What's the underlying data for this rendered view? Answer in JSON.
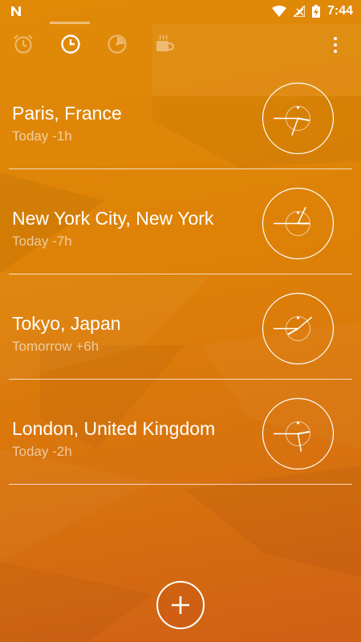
{
  "status_bar": {
    "time": "7:44"
  },
  "tabs": [
    {
      "name": "Alarm",
      "icon": "alarm-clock-icon",
      "selected": false
    },
    {
      "name": "World Clock",
      "icon": "clock-icon",
      "selected": true
    },
    {
      "name": "Timer",
      "icon": "timer-icon",
      "selected": false
    },
    {
      "name": "Bedtime",
      "icon": "coffee-cup-icon",
      "selected": false
    }
  ],
  "cities": [
    {
      "name": "Paris, France",
      "offset": "Today -1h",
      "hour_angle": 100,
      "minute_angle": 200
    },
    {
      "name": "New York City, New York",
      "offset": "Today -7h",
      "hour_angle": 90,
      "minute_angle": 25
    },
    {
      "name": "Tokyo, Japan",
      "offset": "Tomorrow +6h",
      "hour_angle": 240,
      "minute_angle": 50
    },
    {
      "name": "London, United Kingdom",
      "offset": "Today -2h",
      "hour_angle": 80,
      "minute_angle": 170
    }
  ],
  "colors": {
    "accent": "#de8207",
    "text_secondary": "rgba(255,255,255,0.6)"
  }
}
